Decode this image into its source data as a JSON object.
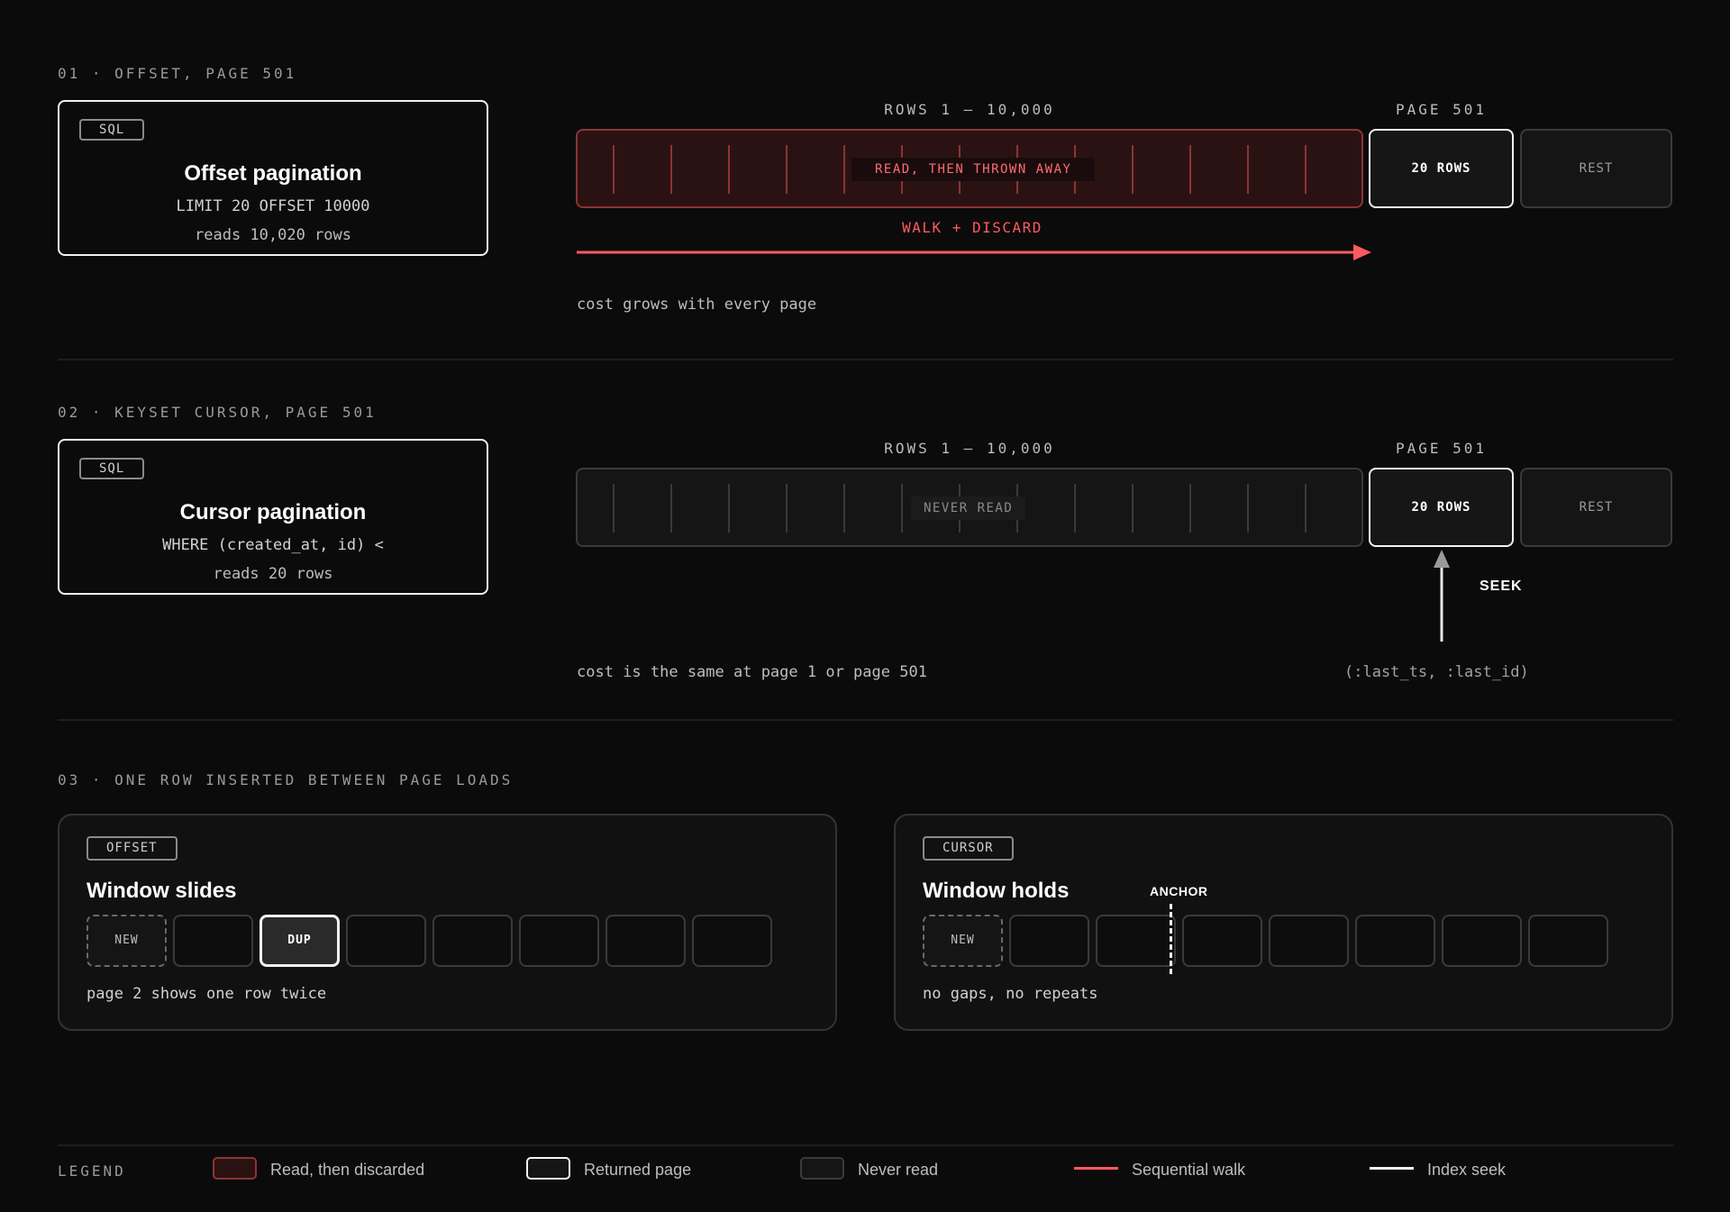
{
  "colors": {
    "accent_red": "#ff5a5f",
    "discard_fill": "#2a1213",
    "discard_border": "#8c3434",
    "returned_border": "#f2f2f2",
    "never_read_border": "#3a3a3a"
  },
  "section1": {
    "label": "01 · OFFSET, PAGE 501",
    "card": {
      "tag": "SQL",
      "title": "Offset pagination",
      "code": "LIMIT 20 OFFSET 10000",
      "sub": "reads 10,020 rows"
    },
    "rows_label": "ROWS 1 – 10,000",
    "page_label": "PAGE 501",
    "bar_text": "READ, THEN THROWN AWAY",
    "page_box": "20 ROWS",
    "rest_box": "REST",
    "walk_label": "WALK + DISCARD",
    "note": "cost grows with every page"
  },
  "section2": {
    "label": "02 · KEYSET CURSOR, PAGE 501",
    "card": {
      "tag": "SQL",
      "title": "Cursor pagination",
      "code": "WHERE (created_at, id) <",
      "sub": "reads 20 rows"
    },
    "rows_label": "ROWS 1 – 10,000",
    "page_label": "PAGE 501",
    "bar_text": "NEVER READ",
    "page_box": "20 ROWS",
    "rest_box": "REST",
    "seek_label": "SEEK",
    "note": "cost is the same at page 1 or page 501",
    "params": "(:last_ts, :last_id)"
  },
  "section3": {
    "label": "03 · ONE ROW INSERTED BETWEEN PAGE LOADS",
    "offset_panel": {
      "tag": "OFFSET",
      "title": "Window slides",
      "cells": [
        "NEW",
        "",
        "DUP",
        "",
        "",
        "",
        "",
        ""
      ],
      "note": "page 2 shows one row twice"
    },
    "cursor_panel": {
      "tag": "CURSOR",
      "title": "Window holds",
      "anchor_label": "ANCHOR",
      "cells": [
        "NEW",
        "",
        "",
        "",
        "",
        "",
        "",
        ""
      ],
      "note": "no gaps, no repeats"
    }
  },
  "legend": {
    "title": "LEGEND",
    "items": [
      {
        "label": "Read, then discarded",
        "icon": "discarded-swatch"
      },
      {
        "label": "Returned page",
        "icon": "returned-swatch"
      },
      {
        "label": "Never read",
        "icon": "never-read-swatch"
      },
      {
        "label": "Sequential walk",
        "icon": "red-line"
      },
      {
        "label": "Index seek",
        "icon": "white-line"
      }
    ]
  }
}
